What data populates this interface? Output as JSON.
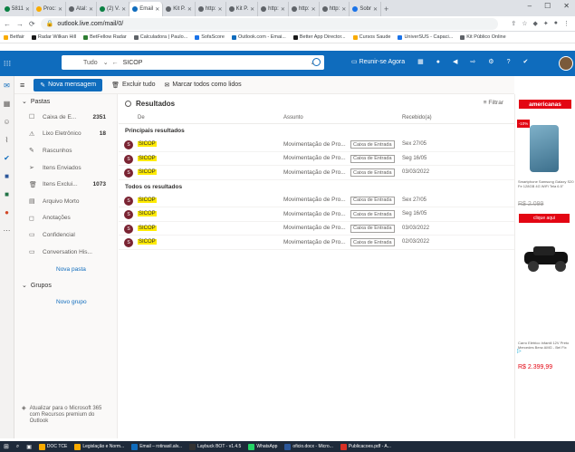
{
  "browser": {
    "tabs": [
      {
        "label": "5811",
        "color": "#0b8043"
      },
      {
        "label": "Proc:",
        "color": "#f9ab00"
      },
      {
        "label": "Atal:",
        "color": "#5f6368"
      },
      {
        "label": "(2) V.",
        "color": "#0b8043"
      },
      {
        "label": "Email",
        "color": "#0f6cbd"
      },
      {
        "label": "Kit P.",
        "color": "#5f6368"
      },
      {
        "label": "http:",
        "color": "#5f6368"
      },
      {
        "label": "Kit P.",
        "color": "#5f6368"
      },
      {
        "label": "http:",
        "color": "#5f6368"
      },
      {
        "label": "http:",
        "color": "#5f6368"
      },
      {
        "label": "http:",
        "color": "#5f6368"
      },
      {
        "label": "Sobr",
        "color": "#1a73e8"
      }
    ],
    "active_tab_index": 4,
    "url": "outlook.live.com/mail/0/",
    "bookmarks": [
      {
        "label": "Betfair",
        "color": "#f9ab00"
      },
      {
        "label": "Radar Wilkan Hill",
        "color": "#1a1a1a"
      },
      {
        "label": "BetFellow Radar",
        "color": "#2e7d32"
      },
      {
        "label": "Calculadora | Paulo...",
        "color": "#5f6368"
      },
      {
        "label": "SofaScore",
        "color": "#1a73e8"
      },
      {
        "label": "Outlook.com - Emai...",
        "color": "#0f6cbd"
      },
      {
        "label": "Better App Director...",
        "color": "#1a1a1a"
      },
      {
        "label": "Cursos Saude",
        "color": "#f9ab00"
      },
      {
        "label": "UniverSUS - Capaci...",
        "color": "#1a73e8"
      },
      {
        "label": "Kit Público Online",
        "color": "#5f6368"
      }
    ]
  },
  "outlook": {
    "search_scope": "Tudo",
    "search_value": "SICOP",
    "meet_now": "Reunir-se Agora",
    "new_message": "Nova mensagem",
    "delete_all": "Excluir tudo",
    "mark_all_read": "Marcar todos como lidos",
    "folders_header": "Pastas",
    "folders": [
      {
        "label": "Caixa de E...",
        "count": "2351",
        "icon": "inbox-icon",
        "glyph": "☐"
      },
      {
        "label": "Lixo Eletrônico",
        "count": "18",
        "icon": "junk-icon",
        "glyph": "⚠"
      },
      {
        "label": "Rascunhos",
        "count": "",
        "icon": "drafts-icon",
        "glyph": "✎"
      },
      {
        "label": "Itens Enviados",
        "count": "",
        "icon": "sent-icon",
        "glyph": "➢"
      },
      {
        "label": "Itens Exclui...",
        "count": "1073",
        "icon": "trash-icon",
        "glyph": "🗑"
      },
      {
        "label": "Arquivo Morto",
        "count": "",
        "icon": "archive-icon",
        "glyph": "▤"
      },
      {
        "label": "Anotações",
        "count": "",
        "icon": "notes-icon",
        "glyph": "◻"
      },
      {
        "label": "Confidencial",
        "count": "",
        "icon": "folder-icon",
        "glyph": "▭"
      },
      {
        "label": "Conversation His...",
        "count": "",
        "icon": "folder-icon",
        "glyph": "▭"
      }
    ],
    "new_folder": "Nova pasta",
    "groups_header": "Grupos",
    "new_group": "Novo grupo",
    "upsell": "Atualizar para o Microsoft 365 com Recursos premium do Outlook",
    "results_title": "Resultados",
    "filter": "Filtrar",
    "col_from": "De",
    "col_subject": "Assunto",
    "col_received": "Recebido(a)",
    "top_results_label": "Principais resultados",
    "all_results_label": "Todos os resultados",
    "top_results": [
      {
        "initial": "S",
        "from": "SICOP",
        "subject": "Movimentação de Pro...",
        "folder": "Caixa de Entrada",
        "date": "Sex 27/05"
      },
      {
        "initial": "S",
        "from": "SICOP",
        "subject": "Movimentação de Pro...",
        "folder": "Caixa de Entrada",
        "date": "Seg 16/05"
      },
      {
        "initial": "S",
        "from": "SICOP",
        "subject": "Movimentação de Pro...",
        "folder": "Caixa de Entrada",
        "date": "03/03/2022"
      }
    ],
    "all_results": [
      {
        "initial": "S",
        "from": "SICOP",
        "subject": "Movimentação de Pro...",
        "folder": "Caixa de Entrada",
        "date": "Sex 27/05"
      },
      {
        "initial": "S",
        "from": "SICOP",
        "subject": "Movimentação de Pro...",
        "folder": "Caixa de Entrada",
        "date": "Seg 16/05"
      },
      {
        "initial": "S",
        "from": "SICOP",
        "subject": "Movimentação de Pro...",
        "folder": "Caixa de Entrada",
        "date": "03/03/2022"
      },
      {
        "initial": "S",
        "from": "SICOP",
        "subject": "Movimentação de Pro...",
        "folder": "Caixa de Entrada",
        "date": "02/03/2022"
      }
    ]
  },
  "ad": {
    "brand": "americanas",
    "badge": "-10%",
    "product1": "Smartphone Samsung Galaxy S20 Fe 128GB 4G WiFi Tela 6.5\"",
    "price1": "R$ 2.099",
    "cta": "clique aqui",
    "product2": "Carro Elétrico Infantil 12V Preto Mercedes Benz AMG - Bel Fix",
    "price2": "R$ 2.399,99"
  },
  "taskbar": [
    {
      "label": "DOC TCE",
      "color": "#f9ab00"
    },
    {
      "label": "Legislação e Norm...",
      "color": "#f9ab00"
    },
    {
      "label": "Email – rotinasil.alv...",
      "color": "#0f6cbd"
    },
    {
      "label": "Laybuck BOT - v1.4.5",
      "color": "#333"
    },
    {
      "label": "WhatsApp",
      "color": "#25d366"
    },
    {
      "label": "oficio.docx - Micro...",
      "color": "#2b579a"
    },
    {
      "label": "Publicacoes.pdf - A...",
      "color": "#d93025"
    }
  ],
  "colors": {
    "accent": "#0f6cbd",
    "avatar": "#7a2332",
    "highlight": "#ffeb00",
    "ad_red": "#e30613"
  }
}
